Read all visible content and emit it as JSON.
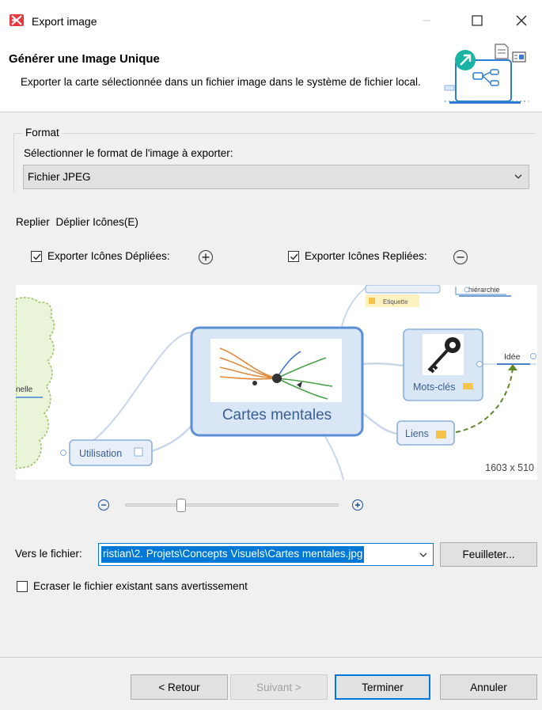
{
  "window": {
    "title": "Export image",
    "controls": [
      "minimize",
      "maximize",
      "close"
    ]
  },
  "header": {
    "title": "Générer une Image Unique",
    "description": "Exporter la carte sélectionnée dans un fichier image dans le système de fichier local."
  },
  "format": {
    "legend": "Format",
    "label": "Sélectionner le format de l'image à exporter:",
    "selected": "Fichier JPEG"
  },
  "fold_tabs": [
    "Replier",
    "Déplier Icônes(E)"
  ],
  "options": {
    "export_unfolded": {
      "label": "Exporter Icônes Dépliées:",
      "checked": true
    },
    "export_folded": {
      "label": "Exporter Icônes Repliées:",
      "checked": true
    }
  },
  "preview": {
    "central_topic": "Cartes mentales",
    "nodes": [
      "Utilisation",
      "Mots-clés",
      "Liens",
      "Etiquette",
      "hiérarchie",
      "Idée",
      "nelle"
    ],
    "dimensions": "1603 x 510"
  },
  "zoom": {
    "level": 0.25
  },
  "output": {
    "label": "Vers le fichier:",
    "path": "ristian\\2. Projets\\Concepts Visuels\\Cartes mentales.jpg",
    "browse_label": "Feuilleter...",
    "overwrite_label": "Ecraser le fichier existant sans avertissement",
    "overwrite_checked": false
  },
  "buttons": {
    "back": "< Retour",
    "next": "Suivant >",
    "finish": "Terminer",
    "cancel": "Annuler"
  },
  "colors": {
    "accent": "#0078d7",
    "app_logo": "#e8373d",
    "node_fill": "#d9e6f5",
    "node_border": "#5b8fd6"
  }
}
